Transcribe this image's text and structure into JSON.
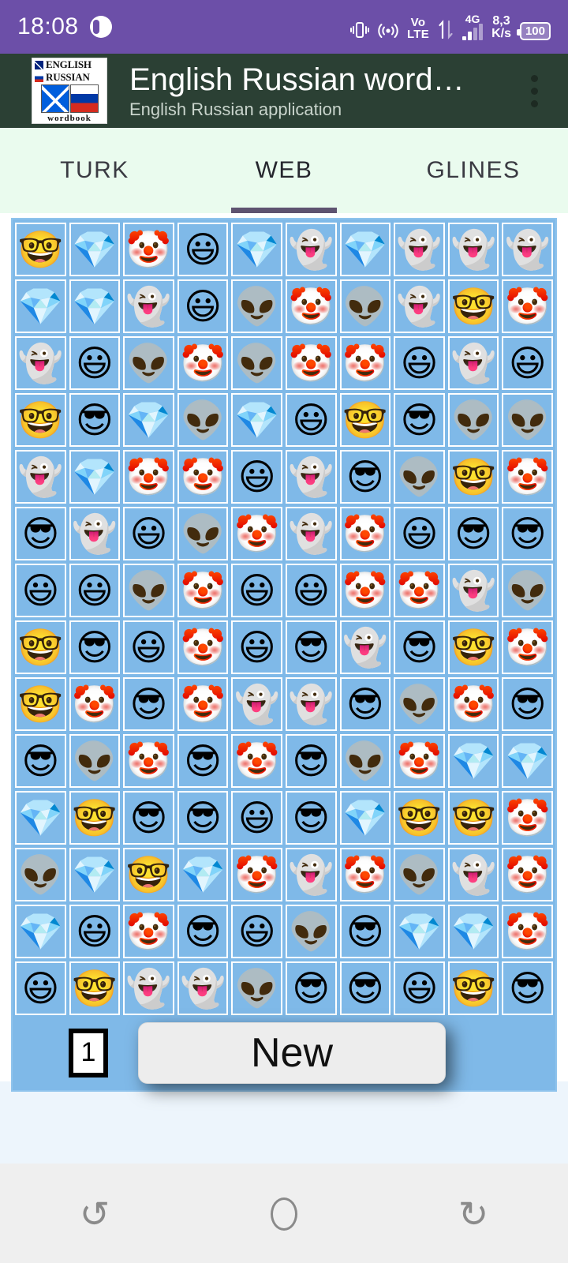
{
  "status_bar": {
    "time": "18:08",
    "icons": [
      "vibrate-icon",
      "cast-icon",
      "volte-icon",
      "data-transfer-icon",
      "signal-4g-icon",
      "network-speed",
      "battery-icon"
    ],
    "volte_top": "Vo",
    "volte_bottom": "LTE",
    "network_generation": "4G",
    "speed_value": "8,3",
    "speed_unit": "K/s",
    "battery_level": "100",
    "background_color": "#6C4FA8"
  },
  "app_bar": {
    "title": "English Russian word…",
    "subtitle": "English Russian application",
    "logo": {
      "line1": "ENGLISH",
      "line2": "RUSSIAN",
      "caption": "wordbook"
    },
    "overflow_label": "More options",
    "background_color": "#2B4034"
  },
  "tabs": {
    "items": [
      {
        "label": "TURK",
        "active": false
      },
      {
        "label": "WEB",
        "active": true
      },
      {
        "label": "GLINES",
        "active": false
      }
    ],
    "background_color": "#EAFBEE",
    "indicator_color": "#5E5370"
  },
  "board": {
    "background_color": "#7FB9E8",
    "columns": 10,
    "rows": 14,
    "tile_glyphs": {
      "nerd": "🤓",
      "diamond": "💎",
      "clown": "🤡",
      "grin": "😃",
      "ghost": "👻",
      "alien": "👽",
      "cool": "😎"
    },
    "tiles": [
      [
        "nerd",
        "diamond",
        "clown",
        "grin",
        "diamond",
        "ghost",
        "diamond",
        "ghost",
        "ghost",
        "ghost"
      ],
      [
        "diamond",
        "diamond",
        "ghost",
        "grin",
        "alien",
        "clown",
        "alien",
        "ghost",
        "nerd",
        "clown"
      ],
      [
        "ghost",
        "grin",
        "alien",
        "clown",
        "alien",
        "clown",
        "clown",
        "grin",
        "ghost",
        "grin"
      ],
      [
        "nerd",
        "cool",
        "diamond",
        "alien",
        "diamond",
        "grin",
        "nerd",
        "cool",
        "alien",
        "alien"
      ],
      [
        "ghost",
        "diamond",
        "clown",
        "clown",
        "grin",
        "ghost",
        "cool",
        "alien",
        "nerd",
        "clown"
      ],
      [
        "cool",
        "ghost",
        "grin",
        "alien",
        "clown",
        "ghost",
        "clown",
        "grin",
        "cool",
        "cool"
      ],
      [
        "grin",
        "grin",
        "alien",
        "clown",
        "grin",
        "grin",
        "clown",
        "clown",
        "ghost",
        "alien"
      ],
      [
        "nerd",
        "cool",
        "grin",
        "clown",
        "grin",
        "cool",
        "ghost",
        "cool",
        "nerd",
        "clown"
      ],
      [
        "nerd",
        "clown",
        "cool",
        "clown",
        "ghost",
        "ghost",
        "cool",
        "alien",
        "clown",
        "cool"
      ],
      [
        "cool",
        "alien",
        "clown",
        "cool",
        "clown",
        "cool",
        "alien",
        "clown",
        "diamond",
        "diamond"
      ],
      [
        "diamond",
        "nerd",
        "cool",
        "cool",
        "grin",
        "cool",
        "diamond",
        "nerd",
        "nerd",
        "clown"
      ],
      [
        "alien",
        "diamond",
        "nerd",
        "diamond",
        "clown",
        "ghost",
        "clown",
        "alien",
        "ghost",
        "clown"
      ],
      [
        "diamond",
        "grin",
        "clown",
        "cool",
        "grin",
        "alien",
        "cool",
        "diamond",
        "diamond",
        "clown"
      ],
      [
        "grin",
        "nerd",
        "ghost",
        "ghost",
        "alien",
        "cool",
        "cool",
        "grin",
        "nerd",
        "cool"
      ]
    ],
    "counter_value": "1",
    "new_button_label": "New"
  },
  "nav_bar": {
    "recents_icon": "recents-icon",
    "home_icon": "home-icon",
    "back_icon": "back-icon",
    "background_color": "#EFEFEF"
  }
}
